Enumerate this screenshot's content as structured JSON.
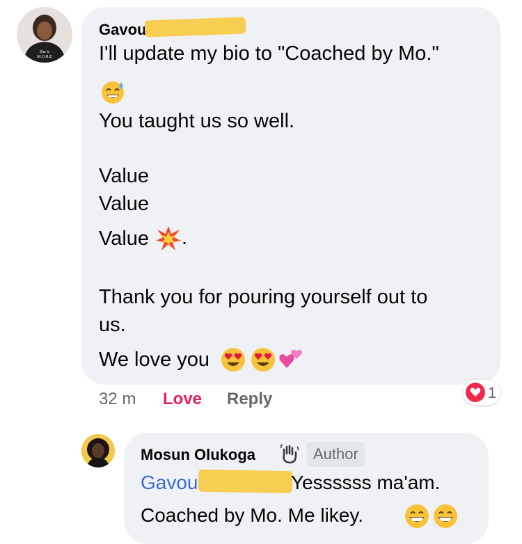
{
  "comment": {
    "author": "Gavou",
    "lines": [
      "I'll update my bio to \"Coached by Mo.\"",
      "You taught us so well.",
      "Value",
      "Value",
      "Value",
      ".",
      "Thank you for pouring yourself out to",
      "us.",
      "We love you"
    ],
    "time": "32 m",
    "love_label": "Love",
    "reply_label": "Reply",
    "reaction_count": "1",
    "avatar_shirt_text": "She is M.O.R.E"
  },
  "reply": {
    "author": "Mosun Olukoga",
    "badge": "Author",
    "mention": "Gavou",
    "text1": "Yessssss ma'am.",
    "text2": "Coached by Mo. Me likey."
  },
  "colors": {
    "bubble": "#eff1f4",
    "love": "#e0245e",
    "mention": "#3b6ccf",
    "redaction": "#f7cd52"
  },
  "icons": [
    "sweat-smile-emoji",
    "collision-emoji",
    "heart-eyes-emoji",
    "revolving-hearts-emoji",
    "wave-hand-icon",
    "heart-reaction-icon",
    "grin-emoji"
  ]
}
